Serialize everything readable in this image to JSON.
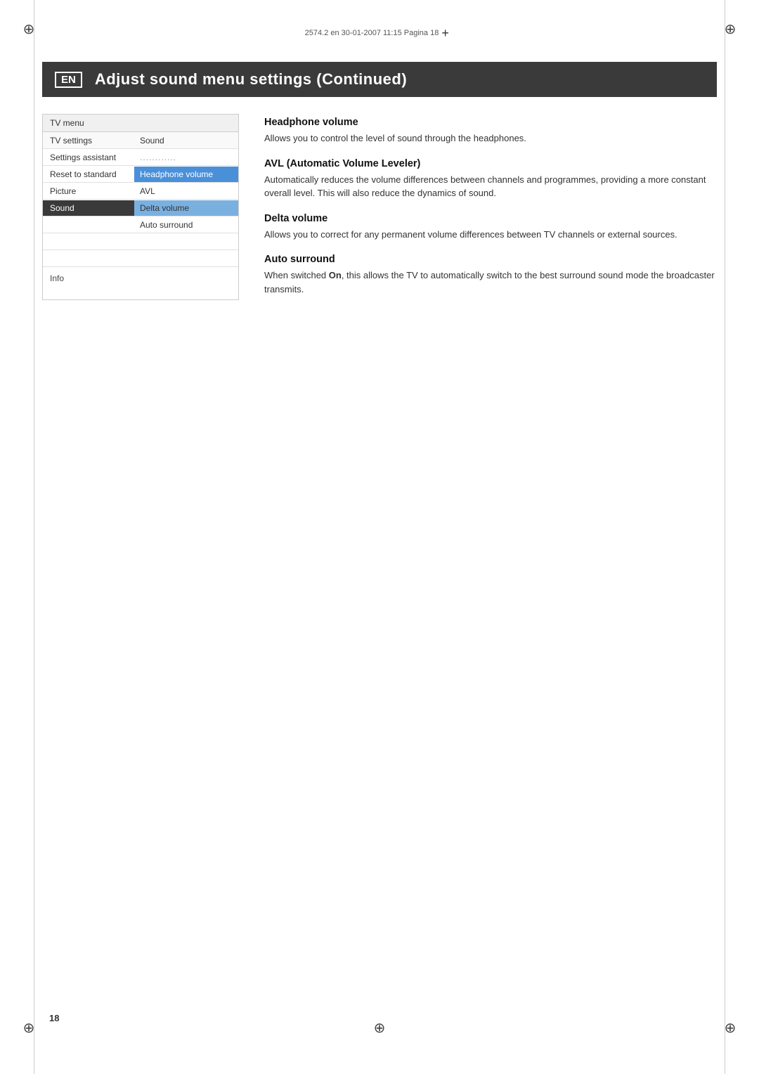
{
  "meta": {
    "text": "2574.2 en  30-01-2007  11:15  Pagina 18"
  },
  "title_banner": {
    "en_label": "EN",
    "title": "Adjust sound menu settings  (Continued)"
  },
  "tv_menu": {
    "header": "TV menu",
    "settings_row": {
      "label": "TV settings",
      "value": "Sound"
    },
    "rows": [
      {
        "left": "Settings assistant",
        "left_selected": false,
        "right": "............",
        "right_class": "dotted",
        "right_highlighted": false
      },
      {
        "left": "Reset to standard",
        "left_selected": false,
        "right": "Headphone volume",
        "right_highlighted": true
      },
      {
        "left": "Picture",
        "left_selected": false,
        "right": "AVL",
        "right_highlighted": false
      },
      {
        "left": "Sound",
        "left_selected": true,
        "right": "Delta volume",
        "right_highlighted": false,
        "right_selected": true
      },
      {
        "left": "",
        "left_selected": false,
        "right": "Auto surround",
        "right_highlighted": false
      }
    ],
    "info": "Info"
  },
  "sections": [
    {
      "title": "Headphone volume",
      "body": "Allows you to control the level of sound through the headphones."
    },
    {
      "title": "AVL (Automatic Volume Leveler)",
      "body": "Automatically reduces the volume differences between channels and programmes, providing a more constant overall level. This will also reduce the dynamics of sound."
    },
    {
      "title": "Delta volume",
      "body": "Allows you to correct for any permanent volume differences between TV channels or external sources."
    },
    {
      "title": "Auto surround",
      "body": "When switched On, this allows the TV to automatically switch to the best surround sound mode the broadcaster transmits."
    }
  ],
  "page_number": "18"
}
